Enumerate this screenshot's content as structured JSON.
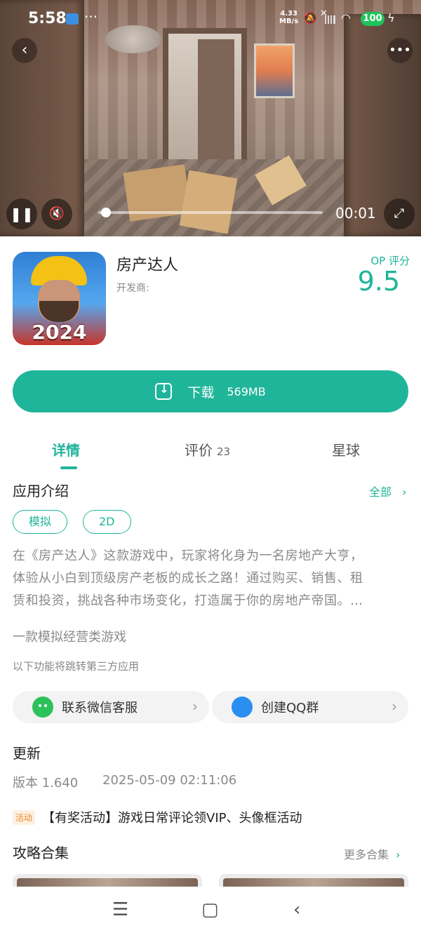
{
  "status_bar": {
    "time": "5:58",
    "dots": "···",
    "net_speed_value": "4.33",
    "net_speed_unit": "MB/s",
    "battery": "100"
  },
  "video": {
    "elapsed": "00:01",
    "progress": 0.02
  },
  "app": {
    "name": "房产达人",
    "developer_label": "开发商:",
    "icon_year": "2024",
    "score_label": "OP 评分",
    "score": "9.5"
  },
  "download": {
    "label": "下载",
    "size": "569MB"
  },
  "tabs": [
    {
      "label": "详情",
      "count": ""
    },
    {
      "label": "评价",
      "count": "23"
    },
    {
      "label": "星球",
      "count": ""
    }
  ],
  "intro": {
    "title": "应用介绍",
    "all_label": "全部",
    "tags": [
      "模拟",
      "2D"
    ],
    "description_lines": [
      "在《房产达人》这款游戏中，玩家将化身为一名房地产大亨，",
      "体验从小白到顶级房产老板的成长之路！通过购买、销售、租",
      "赁和投资，挑战各种市场变化，打造属于你的房地产帝国。…"
    ],
    "subtitle": "一款模拟经营类游戏",
    "third_party_note": "以下功能将跳转第三方应用"
  },
  "links": {
    "wechat": "联系微信客服",
    "qq": "创建QQ群"
  },
  "update": {
    "title": "更新",
    "version": "版本 1.640",
    "date": "2025-05-09 02:11:06"
  },
  "activity": {
    "badge": "活动",
    "text": "【有奖活动】游戏日常评论领VIP、头像框活动"
  },
  "guides": {
    "title": "攻略合集",
    "more_label": "更多合集"
  },
  "colors": {
    "accent": "#1fb59a",
    "battery": "#1fc35c",
    "activity_badge": "#e88a2d"
  }
}
